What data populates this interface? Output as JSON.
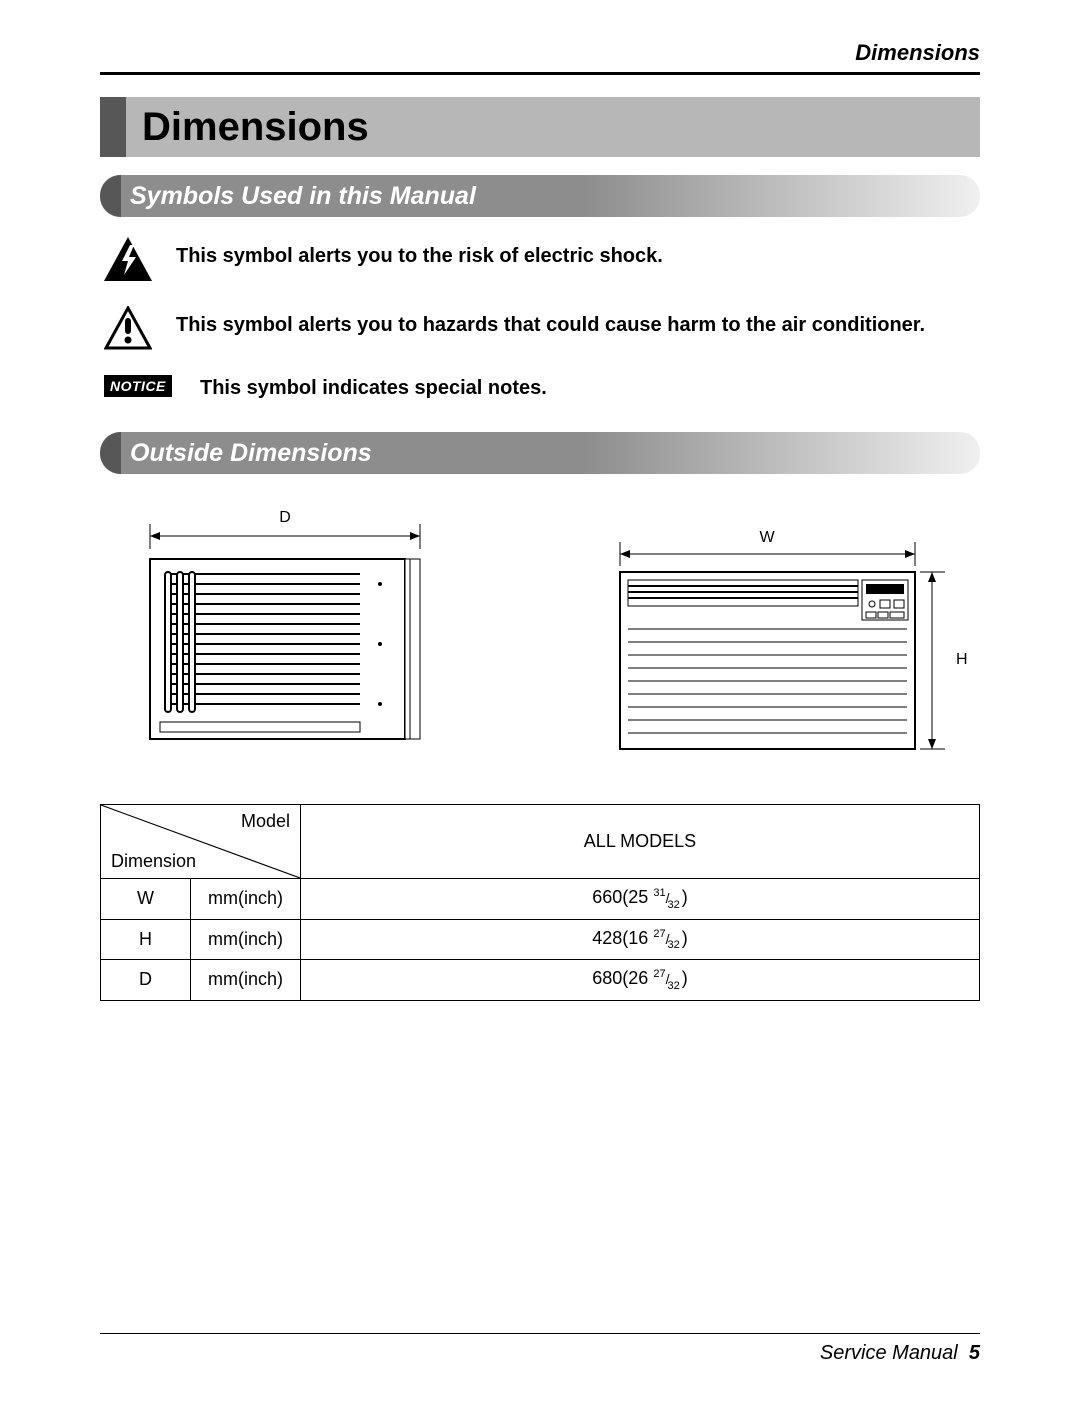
{
  "header": {
    "running_head": "Dimensions",
    "title": "Dimensions"
  },
  "sections": {
    "symbols": {
      "heading": "Symbols Used in this Manual",
      "items": [
        {
          "icon": "electric-shock-icon",
          "text": "This symbol alerts you to the risk of electric shock."
        },
        {
          "icon": "warning-icon",
          "text": "This symbol alerts you to hazards that could cause harm to the air conditioner."
        },
        {
          "icon": "notice-badge",
          "badge_text": "NOTICE",
          "text": "This symbol indicates special notes."
        }
      ]
    },
    "outside": {
      "heading": "Outside Dimensions",
      "labels": {
        "D": "D",
        "W": "W",
        "H": "H"
      }
    }
  },
  "table": {
    "corner": {
      "model": "Model",
      "dimension": "Dimension"
    },
    "col_header": "ALL MODELS",
    "unit_label": "mm(inch)",
    "rows": [
      {
        "dim": "W",
        "mm": "660",
        "inch_whole": "25",
        "inch_num": "31",
        "inch_den": "32"
      },
      {
        "dim": "H",
        "mm": "428",
        "inch_whole": "16",
        "inch_num": "27",
        "inch_den": "32"
      },
      {
        "dim": "D",
        "mm": "680",
        "inch_whole": "26",
        "inch_num": "27",
        "inch_den": "32"
      }
    ]
  },
  "footer": {
    "text": "Service Manual",
    "page": "5"
  }
}
